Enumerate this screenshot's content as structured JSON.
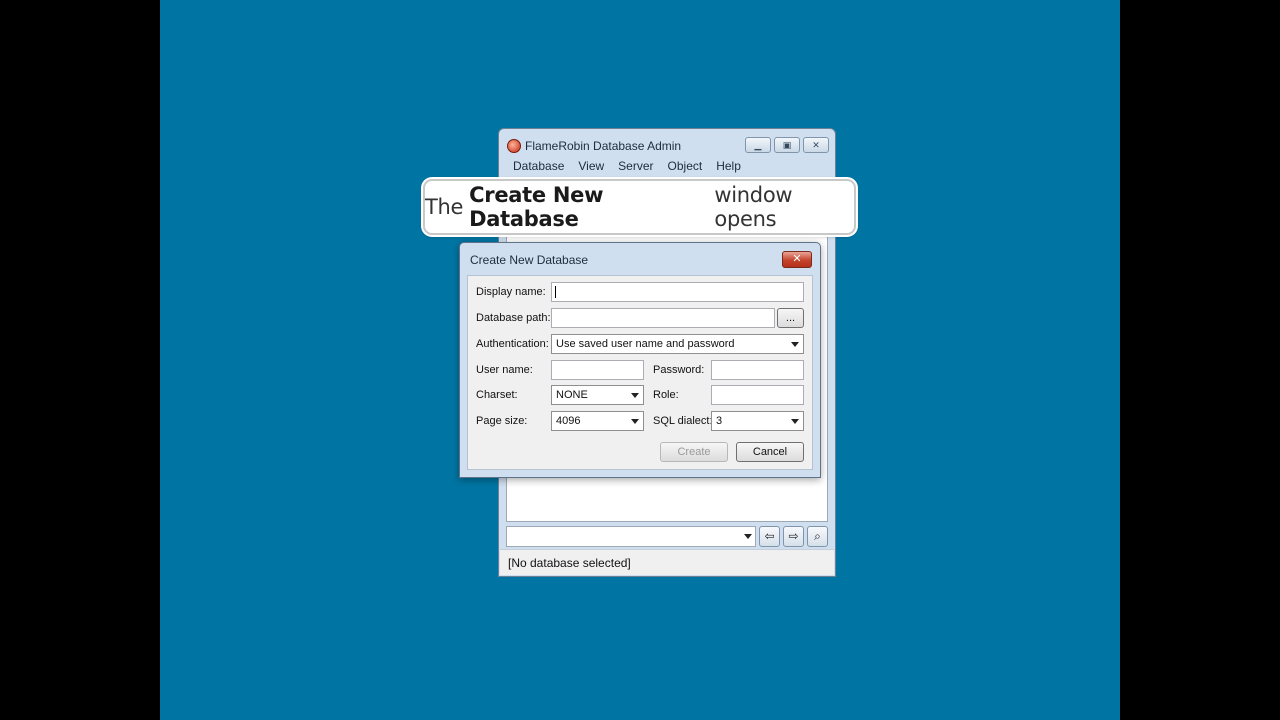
{
  "main_window": {
    "title": "FlameRobin Database Admin",
    "menu": [
      "Database",
      "View",
      "Server",
      "Object",
      "Help"
    ],
    "status": "[No database selected]"
  },
  "callout": {
    "pre": "The",
    "bold": "Create New Database",
    "post": "window opens"
  },
  "dialog": {
    "title": "Create New Database",
    "display_name_label": "Display name:",
    "display_name_value": "",
    "database_path_label": "Database path:",
    "database_path_value": "",
    "browse_label": "...",
    "authentication_label": "Authentication:",
    "authentication_value": "Use saved user name and password",
    "user_name_label": "User name:",
    "password_label": "Password:",
    "charset_label": "Charset:",
    "charset_value": "NONE",
    "role_label": "Role:",
    "page_size_label": "Page size:",
    "page_size_value": "4096",
    "sql_dialect_label": "SQL dialect:",
    "sql_dialect_value": "3",
    "create_label": "Create",
    "cancel_label": "Cancel"
  },
  "colors": {
    "desktop": "#0075a3",
    "window_frame": "#cfdff0",
    "close_button": "#c4442d"
  }
}
